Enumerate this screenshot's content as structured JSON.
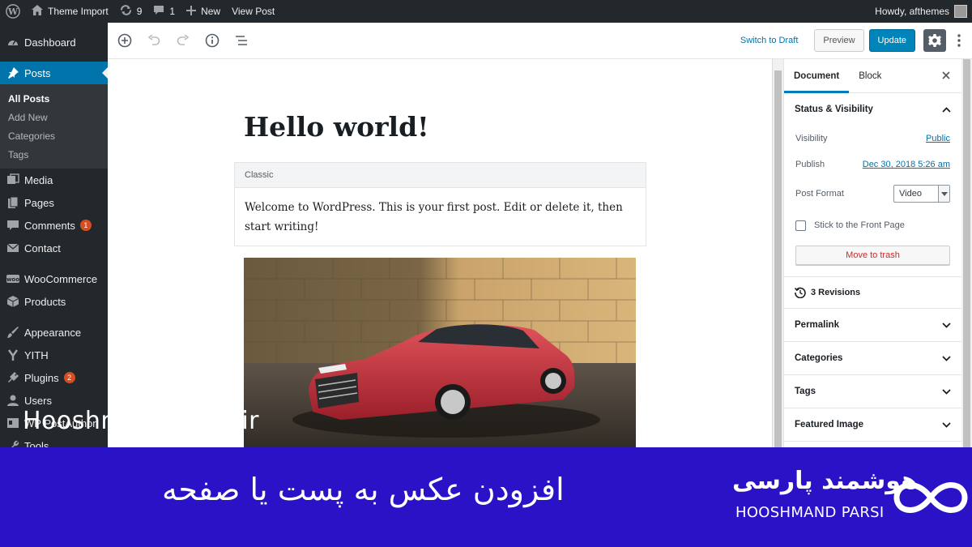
{
  "adminbar": {
    "site_name": "Theme Import",
    "updates_count": "9",
    "comments_count": "1",
    "new_label": "New",
    "view_post_label": "View Post",
    "howdy": "Howdy, afthemes"
  },
  "sidebar": {
    "items": [
      {
        "label": "Dashboard",
        "icon": "dashboard-icon"
      },
      {
        "label": "Posts",
        "icon": "pin-icon"
      },
      {
        "label": "Media",
        "icon": "media-icon"
      },
      {
        "label": "Pages",
        "icon": "pages-icon"
      },
      {
        "label": "Comments",
        "icon": "comments-icon",
        "badge": "1"
      },
      {
        "label": "Contact",
        "icon": "mail-icon"
      },
      {
        "label": "WooCommerce",
        "icon": "woocommerce-icon"
      },
      {
        "label": "Products",
        "icon": "box-icon"
      },
      {
        "label": "Appearance",
        "icon": "brush-icon"
      },
      {
        "label": "YITH",
        "icon": "yith-icon"
      },
      {
        "label": "Plugins",
        "icon": "plug-icon",
        "badge": "2"
      },
      {
        "label": "Users",
        "icon": "user-icon"
      },
      {
        "label": "WP PostAuthor",
        "icon": "id-card-icon"
      },
      {
        "label": "Tools",
        "icon": "wrench-icon"
      }
    ],
    "posts_submenu": [
      "All Posts",
      "Add New",
      "Categories",
      "Tags"
    ]
  },
  "header": {
    "switch_to_draft": "Switch to Draft",
    "preview": "Preview",
    "update": "Update"
  },
  "editor": {
    "title": "Hello world!",
    "classic_label": "Classic",
    "classic_text": "Welcome to WordPress. This is your first post. Edit or delete it, then start writing!",
    "watermark": "Hooshmandparsi.ir"
  },
  "settings": {
    "tab_document": "Document",
    "tab_block": "Block",
    "status_visibility": "Status & Visibility",
    "visibility_label": "Visibility",
    "visibility_value": "Public",
    "publish_label": "Publish",
    "publish_value": "Dec 30, 2018 5:26 am",
    "post_format_label": "Post Format",
    "post_format_value": "Video",
    "stick_label": "Stick to the Front Page",
    "trash_label": "Move to trash",
    "revisions": "3 Revisions",
    "panels": [
      "Permalink",
      "Categories",
      "Tags",
      "Featured Image"
    ]
  },
  "banner": {
    "title": "افزودن عکس به پست یا صفحه",
    "brand_fa": "هوشمند پارسی",
    "brand_en": "HOOSHMAND PARSI",
    "bg_color": "#2a12c6"
  }
}
